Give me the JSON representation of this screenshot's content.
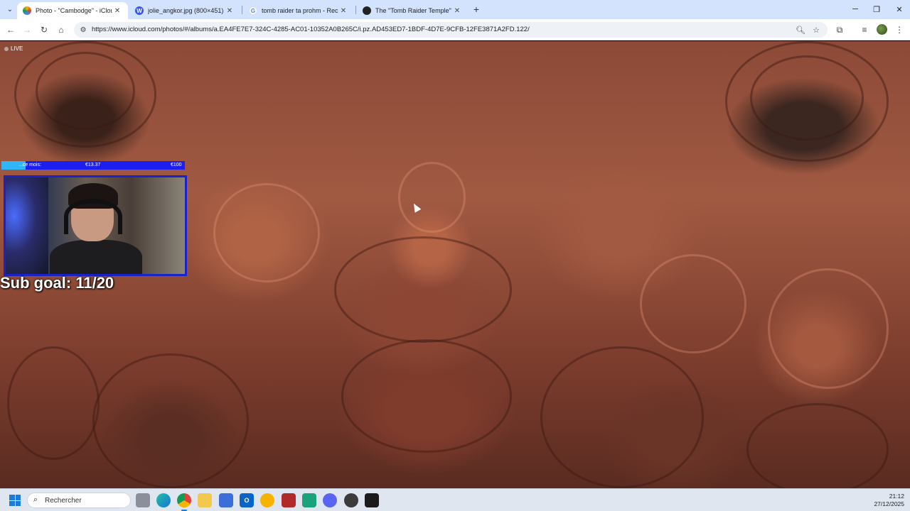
{
  "browser": {
    "tabs": [
      {
        "title": "Photo - \"Cambodge\" - iCloud P",
        "favicon": "photos-icon",
        "active": true
      },
      {
        "title": "jolie_angkor.jpg (800×451)",
        "favicon": "wordpress-icon",
        "active": false
      },
      {
        "title": "tomb raider ta prohm - Recherc",
        "favicon": "google-icon",
        "active": false
      },
      {
        "title": "The \"Tomb Raider Temple\" - Ta",
        "favicon": "site-icon",
        "active": false
      }
    ],
    "url": "https://www.icloud.com/photos/#/albums/a.EA4FE7E7-324C-4285-AC01-10352A0B265C/i.pz.AD453ED7-1BDF-4D7E-9CFB-12FE3871A2FD.122/"
  },
  "stream": {
    "live_label": "LIVE",
    "sub_bar": {
      "label": "...ce mois:",
      "amount": "€13.37",
      "goal": "€100",
      "progress": 0.1337,
      "fill_color": "#2fb6f7",
      "bg_color": "#1d1ff0"
    },
    "sub_goal": "Sub goal: 11/20"
  },
  "taskbar": {
    "search_placeholder": "Rechercher",
    "time": "21:12",
    "date": "27/12/2025",
    "apps": [
      "task-view-icon",
      "edge-icon",
      "chrome-icon",
      "file-explorer-icon",
      "store-icon",
      "outlook-icon",
      "norton-icon",
      "voicemeeter-icon",
      "spreadsheet-icon",
      "discord-icon",
      "obs-icon",
      "audio-app-icon"
    ]
  }
}
